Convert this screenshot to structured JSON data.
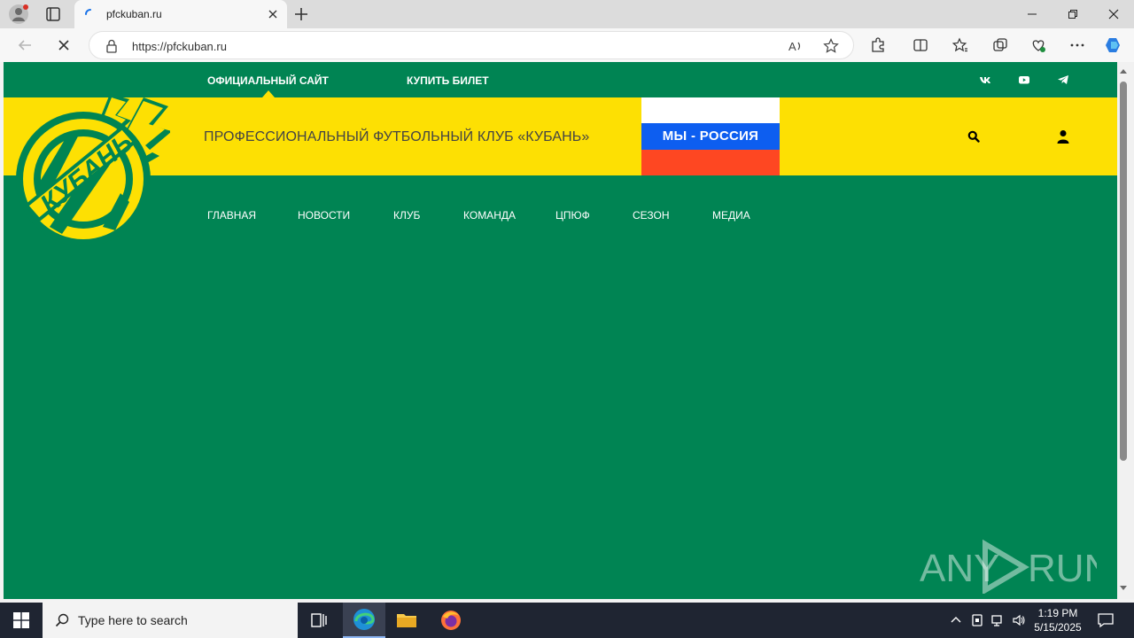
{
  "browser": {
    "tab_title": "pfckuban.ru",
    "url": "https://pfckuban.ru"
  },
  "site": {
    "topbar": {
      "official_site": "ОФИЦИАЛЬНЫЙ САЙТ",
      "buy_ticket": "КУПИТЬ БИЛЕТ"
    },
    "club_name": "ПРОФЕССИОНАЛЬНЫЙ ФУТБОЛЬНЫЙ КЛУБ «КУБАНЬ»",
    "banner_text": "МЫ - РОССИЯ",
    "logo_text": "КУБАНЬ",
    "nav": [
      {
        "label": "ГЛАВНАЯ"
      },
      {
        "label": "НОВОСТИ"
      },
      {
        "label": "КЛУБ"
      },
      {
        "label": "КОМАНДА"
      },
      {
        "label": "ЦПЮФ"
      },
      {
        "label": "СЕЗОН"
      },
      {
        "label": "МЕДИА"
      }
    ],
    "colors": {
      "green": "#008453",
      "yellow": "#fde003"
    }
  },
  "watermark": "ANY RUN",
  "taskbar": {
    "search_placeholder": "Type here to search",
    "time": "1:19 PM",
    "date": "5/15/2025"
  }
}
